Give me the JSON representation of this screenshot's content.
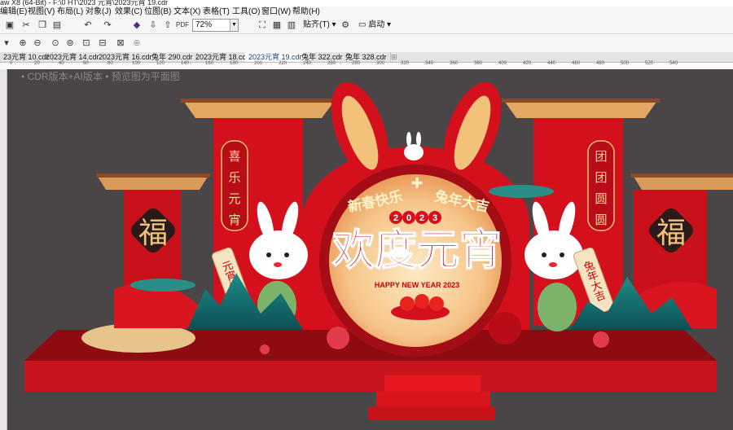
{
  "window": {
    "title": "aw X8 (64-Bit) - F:\\0 HT\\2023 元宵\\2023元宵 19.cdr"
  },
  "menu": [
    "编辑(E)",
    "视图(V)",
    "布局(L)",
    "对象(J)",
    "效果(C)",
    "位图(B)",
    "文本(X)",
    "表格(T)",
    "工具(O)",
    "窗口(W)",
    "帮助(H)"
  ],
  "toolbar": {
    "zoom": "72%",
    "paste_label": "贴齐(T)",
    "launch_label": "启动"
  },
  "tabs": [
    "23元宵 10.cdr",
    "2023元宵 14.cdr",
    "2023元宵 16.cdr",
    "兔年 290.cdr",
    "2023元宵 18.cdr",
    "2023元宵 19.cdr",
    "兔年 322.cdr",
    "兔年 328.cdr"
  ],
  "active_tab_index": 5,
  "ruler": [
    "0",
    "20",
    "40",
    "60",
    "80",
    "100",
    "120",
    "140",
    "160",
    "180",
    "200",
    "220",
    "240",
    "260",
    "280",
    "300",
    "320",
    "340",
    "360",
    "380",
    "400",
    "420",
    "440",
    "460",
    "480",
    "500",
    "520",
    "540"
  ],
  "canvas": {
    "note": "• CDR版本+AI版本  • 预览图为平面图",
    "design": {
      "main_title": "欢度元宵",
      "banner_left": "新春快乐",
      "banner_right": "兔年大吉",
      "year": [
        "2",
        "0",
        "2",
        "3"
      ],
      "happy_new_year": "HAPPY NEW YEAR 2023",
      "left_column": [
        "喜",
        "乐",
        "元",
        "宵"
      ],
      "right_column": [
        "团",
        "团",
        "圆",
        "圆"
      ],
      "fu": "福",
      "scroll_left": "元宵快乐",
      "scroll_right": "兔年大吉"
    }
  },
  "colors": {
    "red": "#d3101c",
    "dark_red": "#a50d16",
    "gold": "#f2c27a",
    "canvas_bg": "#4a4547",
    "teal": "#2a8e86"
  }
}
